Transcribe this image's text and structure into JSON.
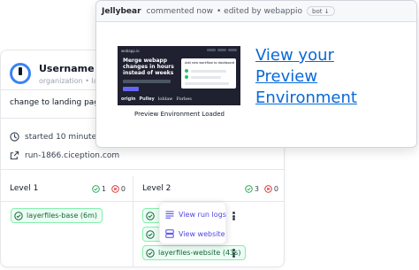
{
  "run": {
    "username": "Username",
    "org_line": "organization • landing",
    "commit_message": "change to landing page",
    "started": "started 10 minutes ago",
    "run_link": "run-1866.ciception.com"
  },
  "levels": [
    {
      "title": "Level 1",
      "passed": "1",
      "failed": "0"
    },
    {
      "title": "Level 2",
      "passed": "3",
      "failed": "0"
    }
  ],
  "jobs": {
    "level1": [
      {
        "label": "layerfiles-base (6m)"
      }
    ],
    "level2": [
      {
        "label": ""
      },
      {
        "label": ""
      },
      {
        "label": "layerfiles-website (43s)"
      }
    ]
  },
  "context_menu": {
    "view_run_logs": "View run logs",
    "view_website": "View website"
  },
  "comment": {
    "author": "Jellybear",
    "action": "commented now",
    "edited_by": "• edited by webappio",
    "badge": "bot ↓",
    "preview_caption": "Preview Environment Loaded",
    "link_text": "View your Preview Environment",
    "thumbnail": {
      "logo": "webapp.io",
      "headline": "Merge webapp changes in hours instead of weeks",
      "card_title": "Add new workflow to dashboard",
      "brands": [
        "origin",
        "Pulley",
        "loblaw",
        "Forbes"
      ]
    }
  },
  "colors": {
    "success": "#166534",
    "success_bg": "#ecfdf5",
    "failure": "#dc2626",
    "link": "#0969da",
    "menu_accent": "#4f46e5"
  },
  "icons": {
    "avatar": "power-icon",
    "clock": "clock-icon",
    "external": "external-link-icon",
    "check": "check-circle-icon",
    "x": "x-circle-icon",
    "logs": "list-icon",
    "website": "stack-icon",
    "kebab": "vertical-dots-icon"
  }
}
